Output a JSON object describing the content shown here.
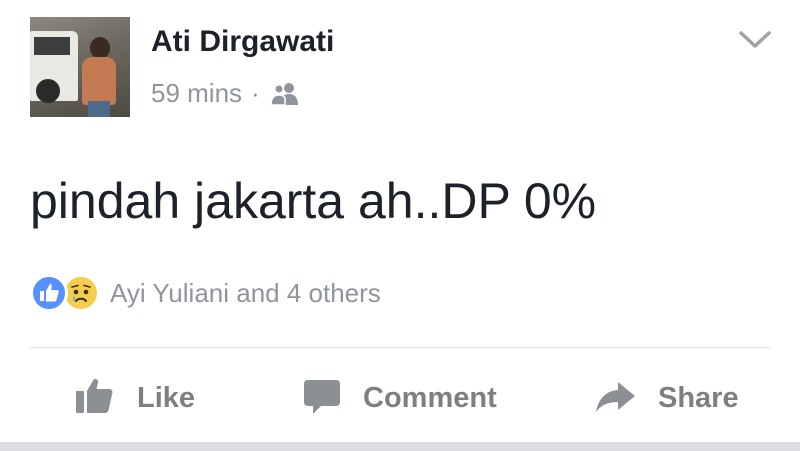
{
  "post": {
    "author": "Ati Dirgawati",
    "time": "59 mins",
    "separator": "·",
    "audience_icon": "friends-icon",
    "text": "pindah jakarta ah..DP 0%",
    "reactions": {
      "icons": [
        "like-reaction-icon",
        "sad-reaction-icon"
      ],
      "summary": "Ayi Yuliani and 4 others"
    }
  },
  "actions": {
    "like": "Like",
    "comment": "Comment",
    "share": "Share"
  },
  "colors": {
    "text": "#1d2129",
    "muted": "#90949c",
    "like_blue": "#5890ff",
    "sad_yellow": "#f7cd4f",
    "action_gray": "#7f7f7f"
  }
}
